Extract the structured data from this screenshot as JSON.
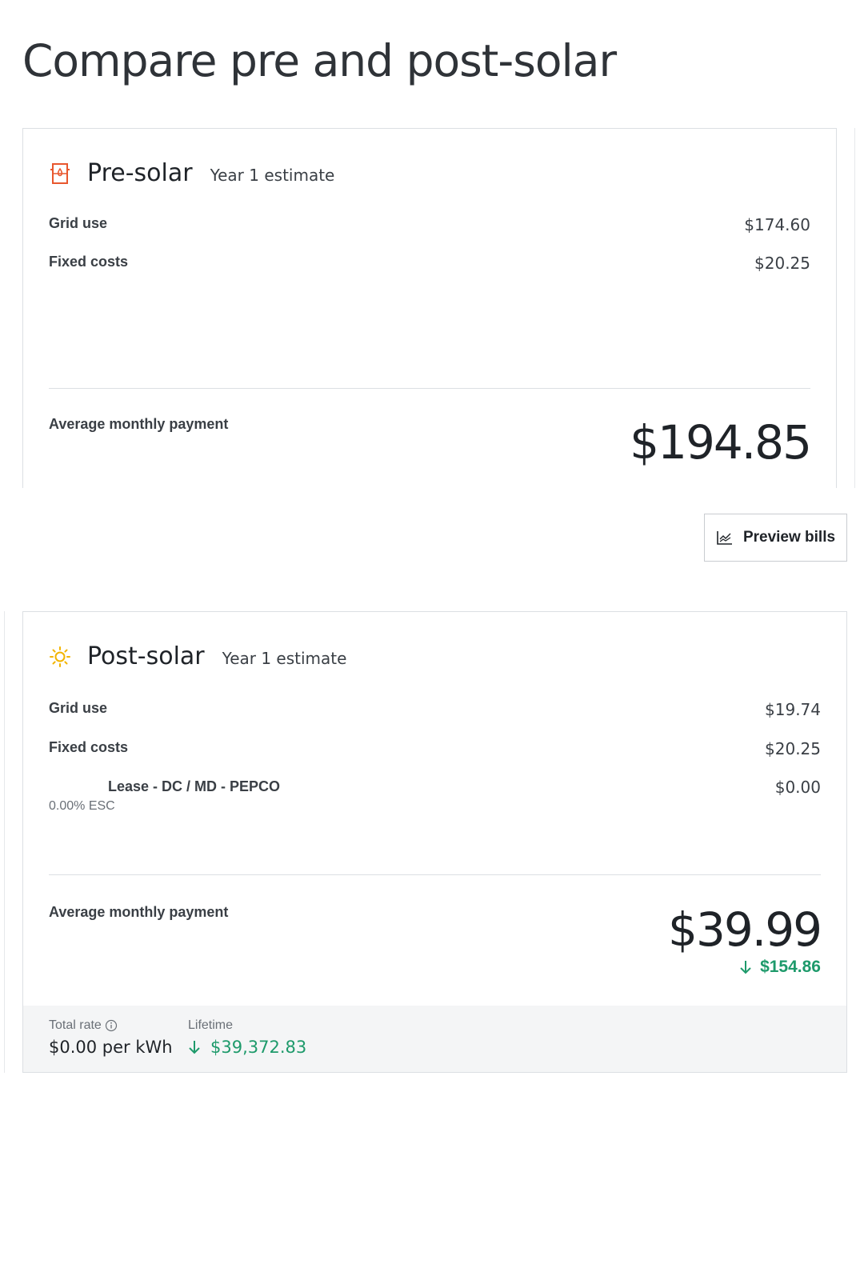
{
  "page": {
    "title": "Compare pre and post-solar"
  },
  "pre_solar": {
    "title": "Pre-solar",
    "subtitle": "Year 1 estimate",
    "icon": "utility-meter-icon",
    "rows": [
      {
        "label": "Grid use",
        "value": "$174.60"
      },
      {
        "label": "Fixed costs",
        "value": "$20.25"
      }
    ],
    "average_label": "Average monthly payment",
    "average_value": "$194.85"
  },
  "preview_bills": {
    "label": "Preview bills",
    "icon": "chart-line-icon"
  },
  "post_solar": {
    "title": "Post-solar",
    "subtitle": "Year 1 estimate",
    "icon": "sun-icon",
    "rows": [
      {
        "label": "Grid use",
        "value": "$19.74"
      },
      {
        "label": "Fixed costs",
        "value": "$20.25"
      }
    ],
    "lease": {
      "name": "Lease - DC / MD - PEPCO",
      "escalator": "0.00% ESC",
      "value": "$0.00"
    },
    "average_label": "Average monthly payment",
    "average_value": "$39.99",
    "monthly_savings": "$154.86",
    "footer": {
      "total_rate_label": "Total rate",
      "total_rate_value": "$0.00 per kWh",
      "lifetime_label": "Lifetime",
      "lifetime_value": "$39,372.83"
    }
  },
  "colors": {
    "accent_orange": "#e8572e",
    "sun_yellow": "#f2b400",
    "savings_green": "#1e9a6b"
  }
}
